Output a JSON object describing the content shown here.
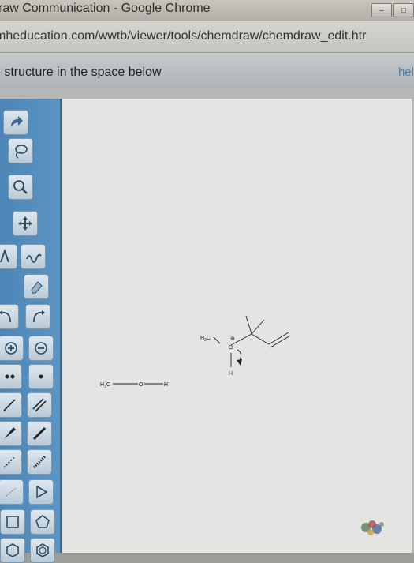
{
  "window": {
    "title": "raw Communication - Google Chrome",
    "controls": {
      "minimize": "–",
      "maximize": "□"
    }
  },
  "address": {
    "url": "mheducation.com/wwtb/viewer/tools/chemdraw/chemdraw_edit.htr"
  },
  "instruction": {
    "text": "e structure in the space below",
    "help_label": "hel"
  },
  "palette": {
    "tools": [
      {
        "name": "redo-arrow-icon"
      },
      {
        "name": "lasso-icon"
      },
      {
        "name": "zoom-icon"
      },
      {
        "name": "move-arrows-icon"
      },
      {
        "name": "text-tool-icon"
      },
      {
        "name": "eraser-icon"
      },
      {
        "name": "arc-arrow-icon"
      },
      {
        "name": "plus-charge-icon"
      },
      {
        "name": "minus-charge-icon"
      },
      {
        "name": "lone-pair-icon"
      },
      {
        "name": "radical-icon"
      },
      {
        "name": "single-bond-icon"
      },
      {
        "name": "double-bond-icon"
      },
      {
        "name": "wedge-bond-icon"
      },
      {
        "name": "dash-bond-icon"
      },
      {
        "name": "triangle-ring-icon"
      },
      {
        "name": "square-ring-icon"
      },
      {
        "name": "pentagon-ring-icon"
      },
      {
        "name": "hexagon-ring-icon"
      }
    ]
  },
  "molecules": {
    "methanol": {
      "carbon": "H3C",
      "oxygen": "O",
      "hydrogen": "H"
    },
    "oxonium": {
      "carbon": "H3C",
      "oxygen": "O",
      "charge": "⊕",
      "hydrogen": "H"
    }
  }
}
